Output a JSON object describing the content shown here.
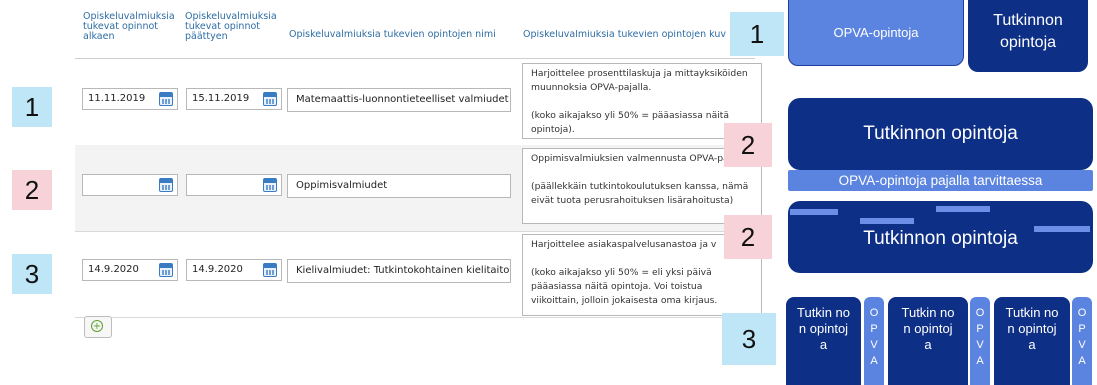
{
  "table": {
    "headers": {
      "start": "Opiskeluvalmiuksia tukevat opinnot alkaen",
      "end": "Opiskeluvalmiuksia tukevat opinnot päättyen",
      "name": "Opiskeluvalmiuksia tukevien opintojen nimi",
      "desc": "Opiskeluvalmiuksia tukevien opintojen kuv"
    },
    "rows": [
      {
        "start": "11.11.2019",
        "end": "15.11.2019",
        "name": "Matemaattis-luonnontieteelliset valmiudet",
        "desc1": "Harjoittelee prosenttilaskuja ja mittayksiköiden muunnoksia OPVA-pajalla.",
        "desc2": "(koko aikajakso yli 50% = pääasiassa näitä opintoja)."
      },
      {
        "start": "",
        "end": "",
        "name": "Oppimisvalmiudet",
        "desc1": "Oppimisvalmiuksien valmennusta OPVA-pajalla",
        "desc2": "(päällekkäin tutkintokoulutuksen kanssa, nämä eivät tuota perusrahoituksen lisärahoitusta)"
      },
      {
        "start": "14.9.2020",
        "end": "14.9.2020",
        "name": "Kielivalmiudet: Tutkintokohtainen kielitaito",
        "desc1": "Harjoittelee asiakaspalvelusanastoa ja v",
        "desc2": "(koko aikajakso yli 50% = eli yksi päivä pääasiassa näitä opintoja. Voi toistua viikoittain, jolloin jokaisesta oma kirjaus."
      }
    ]
  },
  "badges": {
    "left1": "1",
    "left2": "2",
    "left3": "3",
    "right1": "1",
    "right2a": "2",
    "right2b": "2",
    "right3": "3"
  },
  "diagram": {
    "opva": "OPVA-opintoja",
    "tutkinnon_short": "Tutkinnon opintoja",
    "tutkinnon2": "Tutkinnon opintoja",
    "opva_pajalla": "OPVA-opintoja pajalla tarvittaessa",
    "tutkinnon3": "Tutkinnon opintoja",
    "block_text": "Tutkin non opintoj a",
    "opva_vertical": "O P V A"
  },
  "colors": {
    "navy": "#0d2f86",
    "light_blue": "#5b83e0",
    "badge_blue": "#bfe6f7",
    "badge_pink": "#f7d3d9"
  }
}
